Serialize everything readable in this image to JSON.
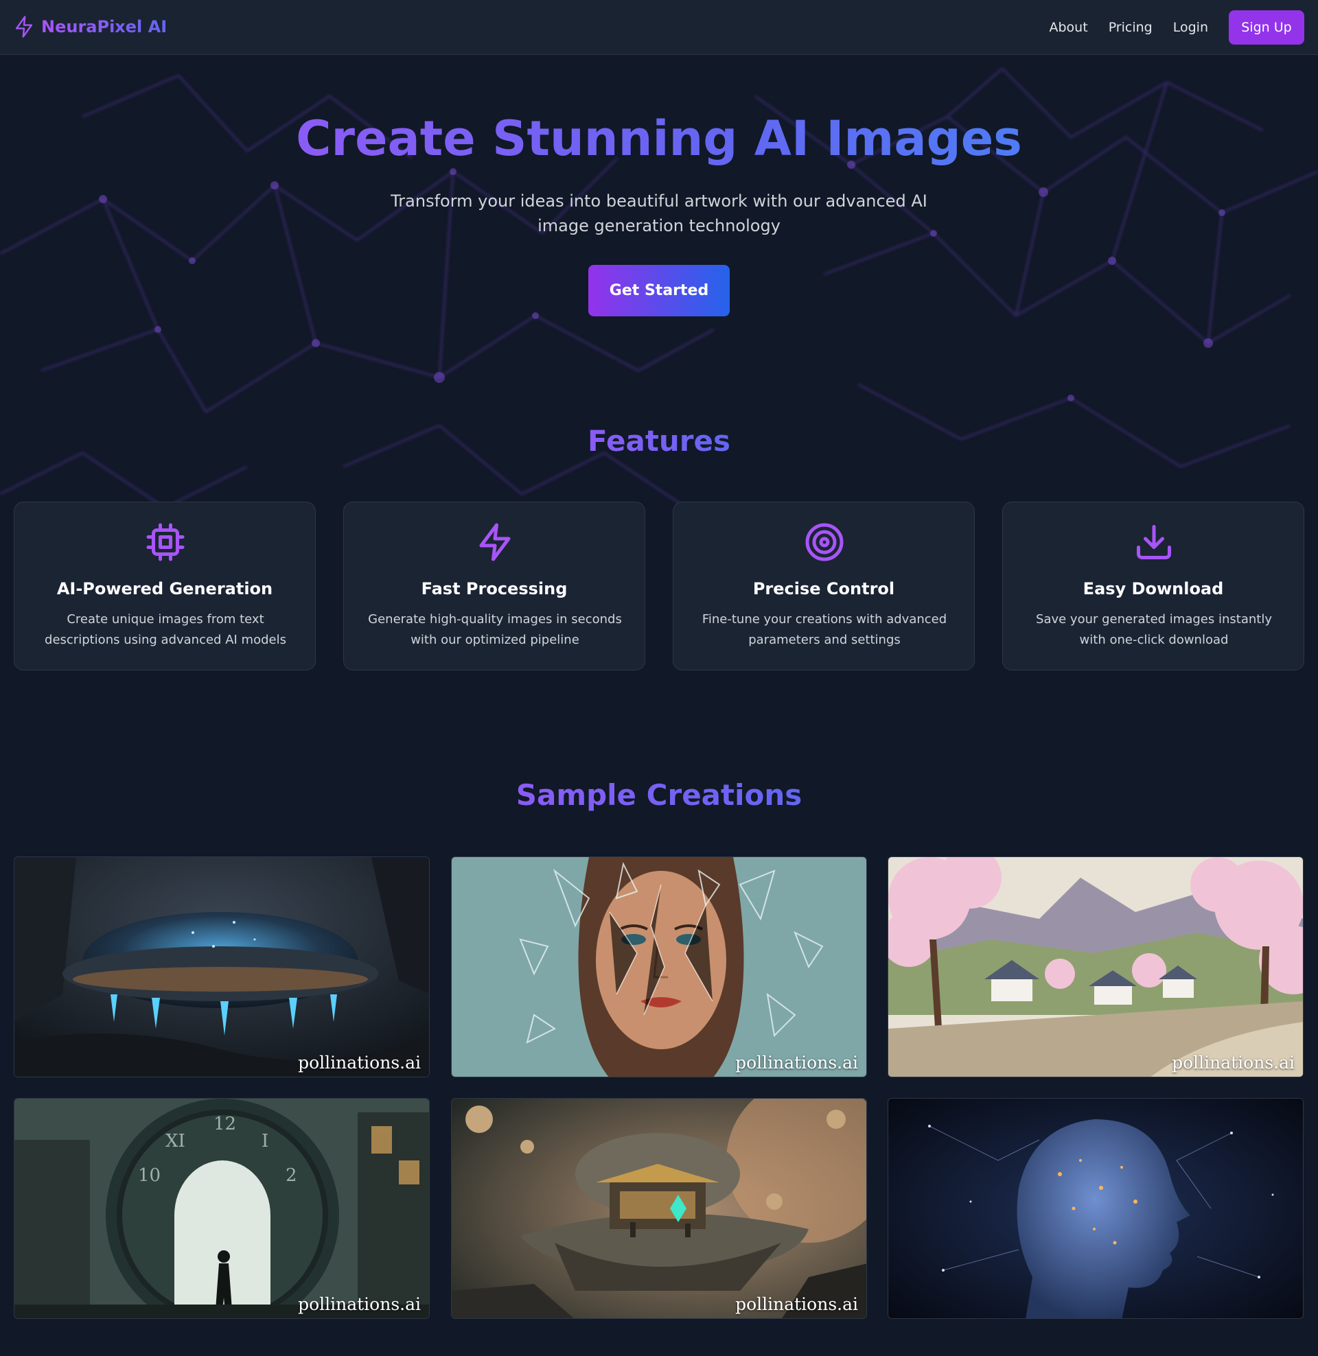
{
  "nav": {
    "brand": "NeuraPixel AI",
    "links": [
      "About",
      "Pricing",
      "Login"
    ],
    "signup_label": "Sign Up"
  },
  "hero": {
    "title": "Create Stunning AI Images",
    "subtitle": "Transform your ideas into beautiful artwork with our advanced AI image generation technology",
    "cta_label": "Get Started"
  },
  "features": {
    "title": "Features",
    "items": [
      {
        "icon": "cpu-icon",
        "title": "AI-Powered Generation",
        "description": "Create unique images from text descriptions using advanced AI models"
      },
      {
        "icon": "lightning-icon",
        "title": "Fast Processing",
        "description": "Generate high-quality images in seconds with our optimized pipeline"
      },
      {
        "icon": "target-icon",
        "title": "Precise Control",
        "description": "Fine-tune your creations with advanced parameters and settings"
      },
      {
        "icon": "download-icon",
        "title": "Easy Download",
        "description": "Save your generated images instantly with one-click download"
      }
    ]
  },
  "gallery": {
    "title": "Sample Creations",
    "watermark": "pollinations.ai",
    "items": [
      {
        "subject": "alien spaceship over rocky canyon",
        "watermarked": true
      },
      {
        "subject": "woman's face shattering like glass",
        "watermarked": true
      },
      {
        "subject": "watercolor village with cherry blossoms",
        "watermarked": true
      },
      {
        "subject": "man walking through giant clock portal",
        "watermarked": true
      },
      {
        "subject": "floating island house in space",
        "watermarked": true
      },
      {
        "subject": "glowing neural human head in cosmos",
        "watermarked": false
      }
    ]
  },
  "colors": {
    "background": "#111827",
    "navbar": "#1a2332",
    "accent_purple": "#9333ea",
    "accent_indigo": "#6366f1",
    "card": "#1b2433"
  }
}
